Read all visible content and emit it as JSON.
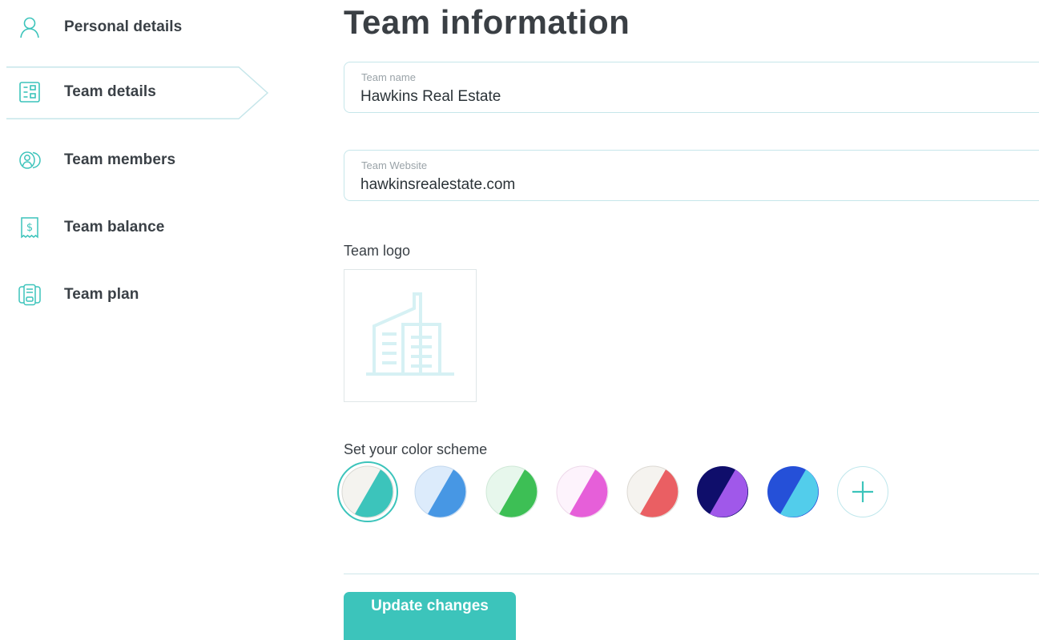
{
  "sidebar": {
    "items": [
      {
        "label": "Personal details",
        "icon": "person-icon",
        "active": false
      },
      {
        "label": "Team details",
        "icon": "id-card-icon",
        "active": true
      },
      {
        "label": "Team members",
        "icon": "team-members-icon",
        "active": false
      },
      {
        "label": "Team balance",
        "icon": "receipt-dollar-icon",
        "active": false
      },
      {
        "label": "Team plan",
        "icon": "plan-card-icon",
        "active": false
      }
    ]
  },
  "main": {
    "title": "Team information",
    "team_name": {
      "label": "Team name",
      "value": "Hawkins Real Estate"
    },
    "team_website": {
      "label": "Team Website",
      "value": "hawkinsrealestate.com"
    },
    "team_logo": {
      "label": "Team logo",
      "placeholder_icon": "building-icon"
    },
    "color_scheme": {
      "label": "Set your color scheme",
      "swatches": [
        {
          "light": "#f4f3ef",
          "dark": "#3cc4bb",
          "selected": true
        },
        {
          "light": "#dcebfb",
          "dark": "#4797e4",
          "selected": false
        },
        {
          "light": "#e7f7ec",
          "dark": "#3dbf55",
          "selected": false
        },
        {
          "light": "#fdf3fc",
          "dark": "#e65fd9",
          "selected": false
        },
        {
          "light": "#f5f3ef",
          "dark": "#ea5f63",
          "selected": false
        },
        {
          "light": "#0f0e6b",
          "dark": "#a058ea",
          "selected": false
        },
        {
          "light": "#2550d8",
          "dark": "#52cdeb",
          "selected": false
        }
      ],
      "add_icon": "plus-icon"
    },
    "update_button": "Update changes"
  },
  "colors": {
    "accent": "#3cc4bb",
    "border": "#c6e6ea",
    "text": "#3a4046",
    "icon_stroke": "#3cc4bb"
  }
}
